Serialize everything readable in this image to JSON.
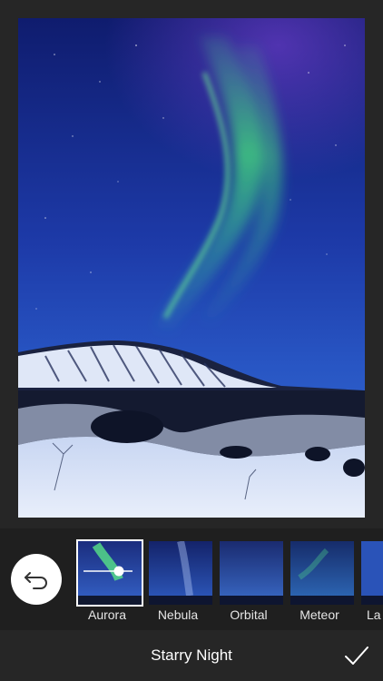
{
  "photo": {
    "subject": "aurora-over-snowy-mountain"
  },
  "filters": {
    "selected_index": 0,
    "slider_value": 0.72,
    "items": [
      {
        "label": "Aurora"
      },
      {
        "label": "Nebula"
      },
      {
        "label": "Orbital"
      },
      {
        "label": "Meteor"
      },
      {
        "label": "La"
      }
    ]
  },
  "toolbar": {
    "title": "Starry Night",
    "undo_icon": "undo-arrow-icon",
    "confirm_icon": "checkmark-icon"
  },
  "colors": {
    "background": "#262626",
    "strip": "#1f1f1f",
    "accent": "#ffffff"
  }
}
